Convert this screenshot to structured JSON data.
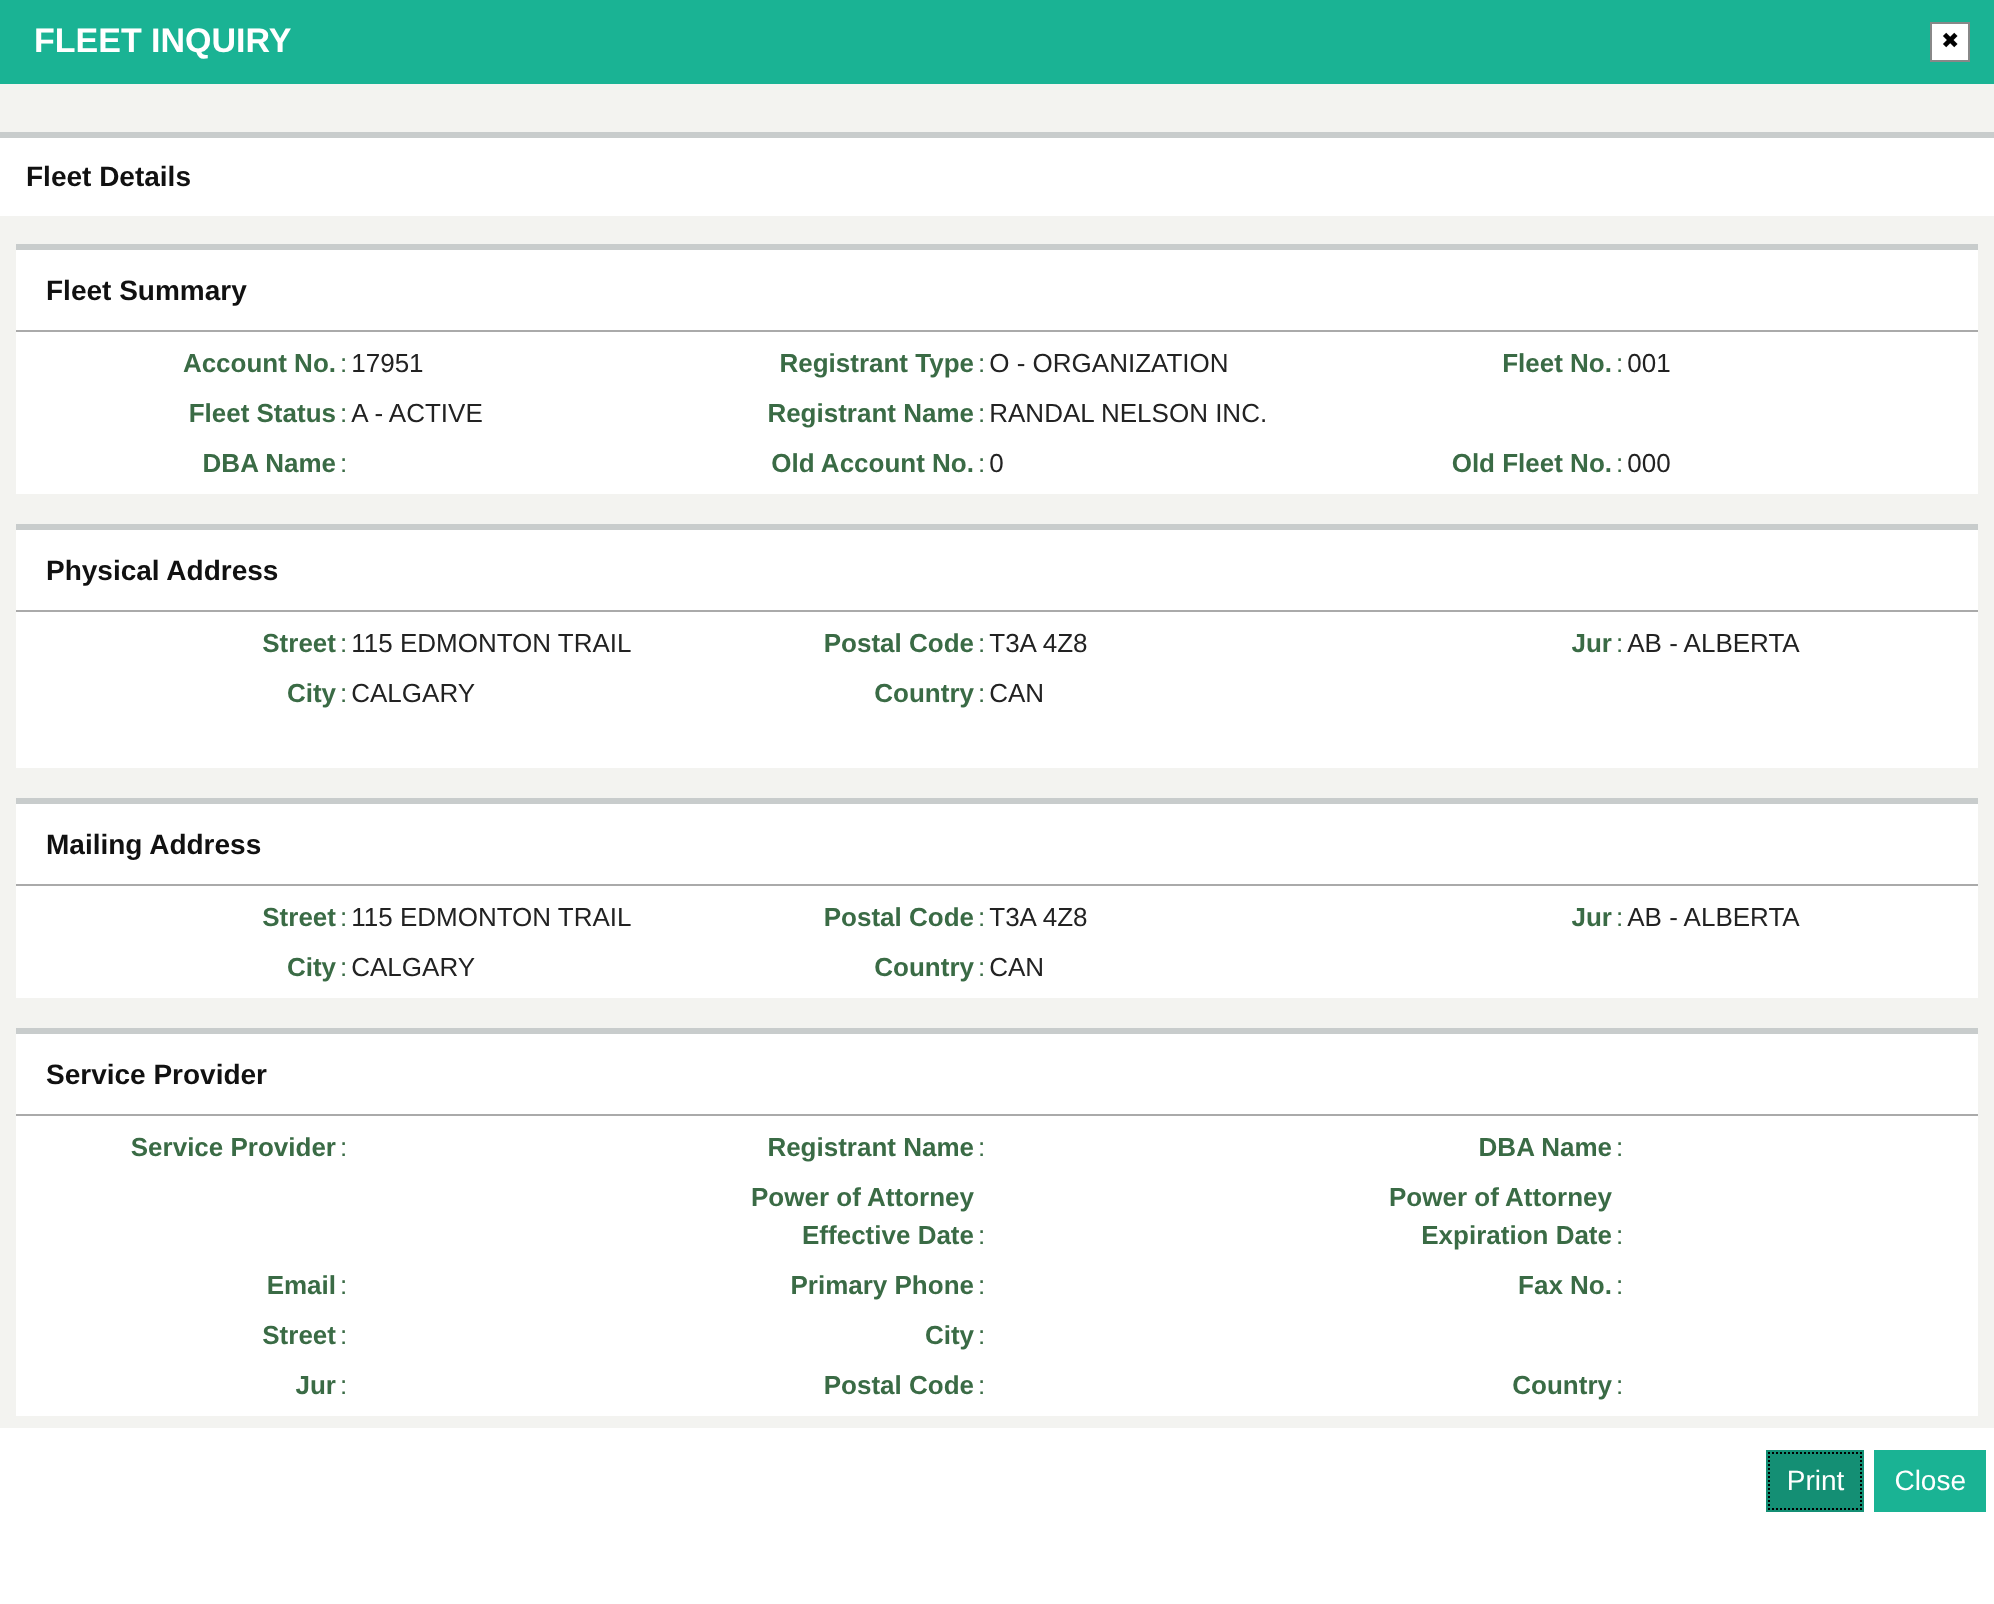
{
  "window": {
    "title": "FLEET INQUIRY",
    "close_icon": "✖"
  },
  "page_title": "Fleet Details",
  "separator": ":",
  "sections": [
    {
      "title": "Fleet Summary",
      "rows": [
        [
          {
            "kind": "field",
            "label": "Account No.",
            "value": "17951"
          },
          {
            "kind": "field",
            "label": "Registrant Type",
            "value": "O - ORGANIZATION"
          },
          {
            "kind": "field",
            "label": "Fleet No.",
            "value": "001"
          }
        ],
        [
          {
            "kind": "field",
            "label": "Fleet Status",
            "value": "A - ACTIVE"
          },
          {
            "kind": "field",
            "label": "Registrant Name",
            "value": "RANDAL NELSON INC."
          },
          {
            "kind": "empty"
          }
        ],
        [
          {
            "kind": "field",
            "label": "DBA Name"
          },
          {
            "kind": "field",
            "label": "Old Account No.",
            "value": "0"
          },
          {
            "kind": "field",
            "label": "Old Fleet No.",
            "value": "000"
          }
        ]
      ]
    },
    {
      "title": "Physical Address",
      "rows": [
        [
          {
            "kind": "field",
            "label": "Street",
            "value": "115 EDMONTON TRAIL"
          },
          {
            "kind": "field",
            "label": "Postal Code",
            "value": "T3A 4Z8"
          },
          {
            "kind": "field",
            "label": "Jur",
            "value": "AB - ALBERTA"
          }
        ],
        [
          {
            "kind": "field",
            "label": "City",
            "value": "CALGARY"
          },
          {
            "kind": "field",
            "label": "Country",
            "value": "CAN"
          },
          {
            "kind": "empty"
          }
        ]
      ]
    },
    {
      "title": "Mailing Address",
      "rows": [
        [
          {
            "kind": "field",
            "label": "Street",
            "value": "115 EDMONTON TRAIL"
          },
          {
            "kind": "field",
            "label": "Postal Code",
            "value": "T3A 4Z8"
          },
          {
            "kind": "field",
            "label": "Jur",
            "value": "AB - ALBERTA"
          }
        ],
        [
          {
            "kind": "field",
            "label": "City",
            "value": "CALGARY"
          },
          {
            "kind": "field",
            "label": "Country",
            "value": "CAN"
          },
          {
            "kind": "empty"
          }
        ]
      ]
    },
    {
      "title": "Service Provider",
      "rows": [
        [
          {
            "kind": "field",
            "label": "Service Provider"
          },
          {
            "kind": "field",
            "label": "Registrant Name"
          },
          {
            "kind": "field",
            "label": "DBA Name"
          }
        ],
        [
          {
            "kind": "empty"
          },
          {
            "kind": "field",
            "label": "Power of Attorney Effective Date"
          },
          {
            "kind": "field",
            "label": "Power of Attorney Expiration Date"
          }
        ],
        [
          {
            "kind": "field",
            "label": "Email"
          },
          {
            "kind": "field",
            "label": "Primary Phone"
          },
          {
            "kind": "field",
            "label": "Fax No."
          }
        ],
        [
          {
            "kind": "field",
            "label": "Street"
          },
          {
            "kind": "field",
            "label": "City"
          },
          {
            "kind": "empty"
          }
        ],
        [
          {
            "kind": "field",
            "label": "Jur"
          },
          {
            "kind": "field",
            "label": "Postal Code"
          },
          {
            "kind": "field",
            "label": "Country"
          }
        ]
      ]
    }
  ],
  "buttons": [
    {
      "label": "Print",
      "focused": true
    },
    {
      "label": "Close",
      "focused": false
    }
  ]
}
